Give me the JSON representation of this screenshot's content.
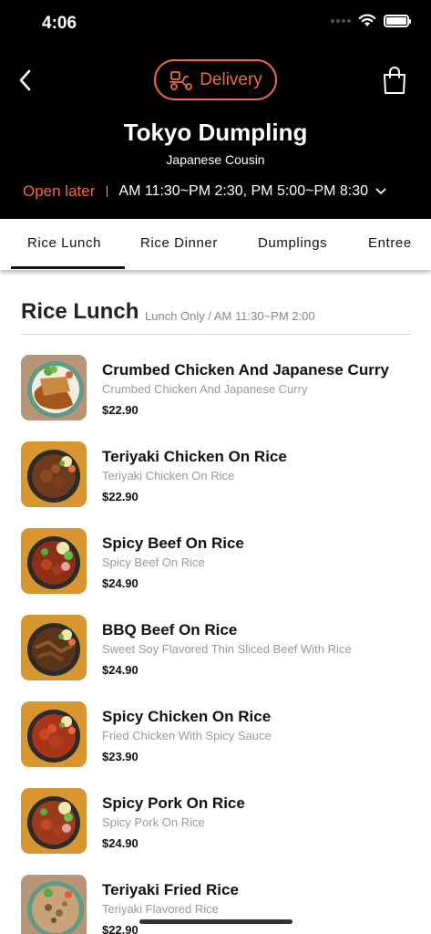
{
  "status_bar": {
    "time": "4:06"
  },
  "header": {
    "delivery_label": "Delivery",
    "store_name": "Tokyo Dumpling",
    "store_subtitle": "Japanese Cousin",
    "open_status": "Open later",
    "hours": "AM 11:30~PM 2:30, PM 5:00~PM 8:30",
    "accent_color": "#ee6a43"
  },
  "tabs": [
    {
      "label": "Rice Lunch",
      "active": true
    },
    {
      "label": "Rice Dinner",
      "active": false
    },
    {
      "label": "Dumplings",
      "active": false
    },
    {
      "label": "Entree",
      "active": false
    }
  ],
  "section": {
    "title": "Rice Lunch",
    "note": "Lunch Only / AM 11:30~PM 2:00"
  },
  "items": [
    {
      "name": "Crumbed Chicken And Japanese Curry",
      "description": "Crumbed Chicken And Japanese Curry",
      "price": "$22.90"
    },
    {
      "name": "Teriyaki Chicken On Rice",
      "description": "Teriyaki Chicken On Rice",
      "price": "$22.90"
    },
    {
      "name": "Spicy Beef On Rice",
      "description": "Spicy Beef On Rice",
      "price": "$24.90"
    },
    {
      "name": "BBQ Beef On Rice",
      "description": "Sweet Soy Flavored Thin Sliced Beef With Rice",
      "price": "$24.90"
    },
    {
      "name": "Spicy Chicken On Rice",
      "description": "Fried Chicken With Spicy Sauce",
      "price": "$23.90"
    },
    {
      "name": "Spicy Pork On Rice",
      "description": "Spicy Pork On Rice",
      "price": "$24.90"
    },
    {
      "name": "Teriyaki Fried Rice",
      "description": "Teriyaki Flavored Rice",
      "price": "$22.90"
    }
  ]
}
